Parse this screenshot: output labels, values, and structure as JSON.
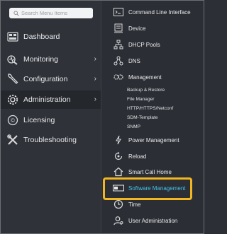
{
  "search": {
    "placeholder": "Search Menu Items"
  },
  "left_menu": [
    {
      "label": "Dashboard",
      "icon": "dashboard-icon",
      "has_submenu": false
    },
    {
      "label": "Monitoring",
      "icon": "monitoring-icon",
      "has_submenu": true
    },
    {
      "label": "Configuration",
      "icon": "wrench-icon",
      "has_submenu": true
    },
    {
      "label": "Administration",
      "icon": "gear-icon",
      "has_submenu": true,
      "active": true
    },
    {
      "label": "Licensing",
      "icon": "license-icon",
      "has_submenu": false
    },
    {
      "label": "Troubleshooting",
      "icon": "tools-icon",
      "has_submenu": false
    }
  ],
  "admin_menu": {
    "items": [
      {
        "label": "Command Line Interface",
        "icon": "terminal-icon"
      },
      {
        "label": "Device",
        "icon": "device-icon"
      },
      {
        "label": "DHCP Pools",
        "icon": "network-icon"
      },
      {
        "label": "DNS",
        "icon": "dns-icon"
      },
      {
        "label": "Management",
        "icon": "management-icon"
      }
    ],
    "management_subitems": [
      "Backup & Restore",
      "File Manager",
      "HTTP/HTTPS/Netconf",
      "SDM-Template",
      "SNMP"
    ],
    "items_after": [
      {
        "label": "Power Management",
        "icon": "power-icon"
      },
      {
        "label": "Reload",
        "icon": "reload-icon"
      },
      {
        "label": "Smart Call Home",
        "icon": "home-icon"
      },
      {
        "label": "Software Management",
        "icon": "software-icon",
        "selected": true
      },
      {
        "label": "Time",
        "icon": "clock-icon"
      },
      {
        "label": "User Administration",
        "icon": "user-icon"
      }
    ]
  },
  "colors": {
    "background": "#2c2f35",
    "highlight_border": "#f2b720",
    "selected_text": "#42c4f0"
  }
}
